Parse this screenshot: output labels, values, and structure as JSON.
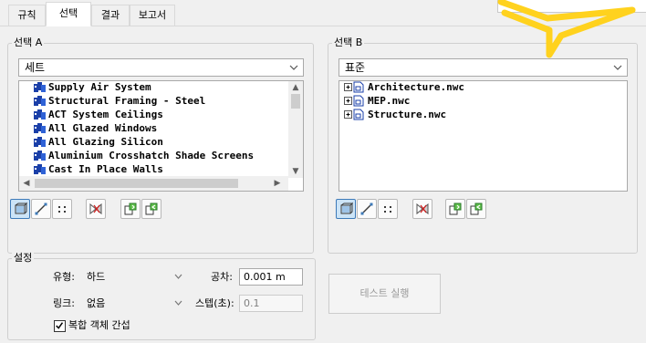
{
  "tabs": [
    {
      "label": "규칙",
      "active": false
    },
    {
      "label": "선택",
      "active": true
    },
    {
      "label": "결과",
      "active": false
    },
    {
      "label": "보고서",
      "active": false
    }
  ],
  "selection_a": {
    "group_label": "선택 A",
    "dropdown_value": "세트",
    "items": [
      "Supply Air System",
      "Structural Framing - Steel",
      "ACT System Ceilings",
      "All Glazed Windows",
      "All Glazing Silicon",
      "Aluminium Crosshatch Shade Screens",
      "Cast In Place Walls"
    ]
  },
  "selection_b": {
    "group_label": "선택 B",
    "dropdown_value": "표준",
    "items": [
      "Architecture.nwc",
      "MEP.nwc",
      "Structure.nwc"
    ]
  },
  "toolbar_icons": [
    "surface-icon",
    "line-icon",
    "points-icon",
    "self-intersect-icon",
    "use-current-selection-icon",
    "select-in-scene-icon"
  ],
  "settings": {
    "group_label": "설정",
    "type_label": "유형:",
    "type_value": "하드",
    "tolerance_label": "공차:",
    "tolerance_value": "0.001 m",
    "link_label": "링크:",
    "link_value": "없음",
    "step_label": "스텝(초):",
    "step_value": "0.1",
    "composite_label": "복합 객체 간섭",
    "composite_checked": true
  },
  "test_run_button": "테스트 실행",
  "colors": {
    "accent": "#3d7ab8",
    "highlight": "#ffd21e",
    "icon_blue": "#1a3fa8"
  }
}
